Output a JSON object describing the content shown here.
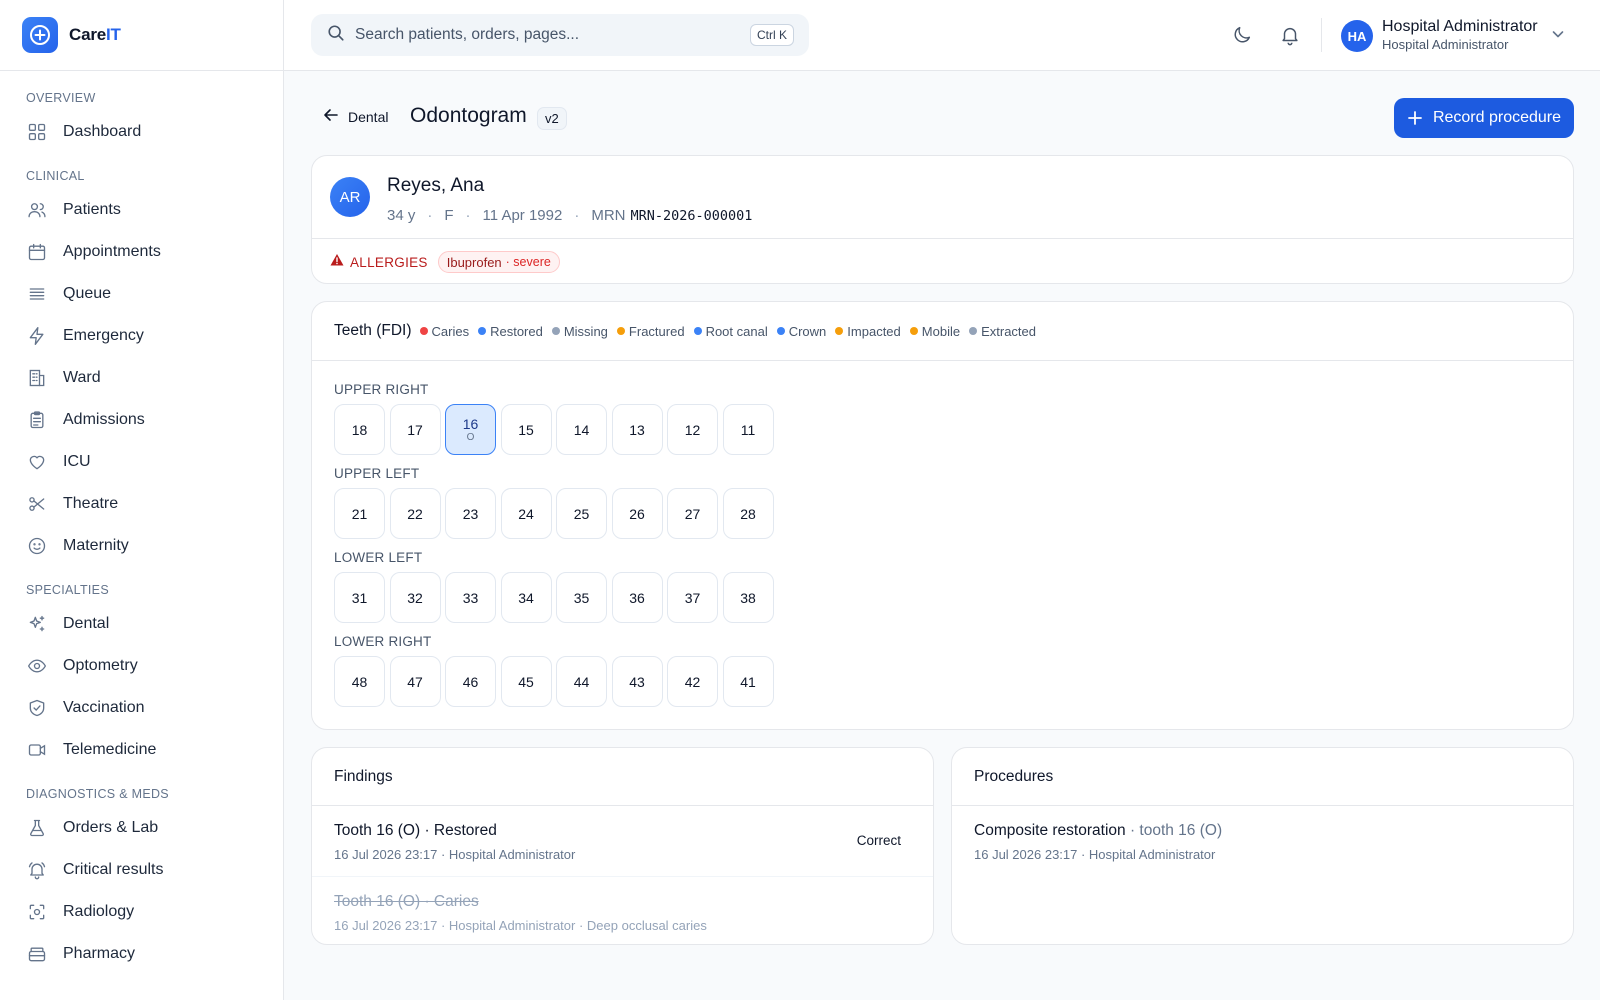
{
  "brand": {
    "name_main": "Care",
    "name_accent": "IT"
  },
  "sidebar": {
    "sections": [
      {
        "title": "OVERVIEW",
        "items": [
          {
            "label": "Dashboard",
            "icon": "grid-icon"
          }
        ]
      },
      {
        "title": "CLINICAL",
        "items": [
          {
            "label": "Patients",
            "icon": "users-icon"
          },
          {
            "label": "Appointments",
            "icon": "calendar-icon"
          },
          {
            "label": "Queue",
            "icon": "list-icon"
          },
          {
            "label": "Emergency",
            "icon": "bolt-icon"
          },
          {
            "label": "Ward",
            "icon": "building-icon"
          },
          {
            "label": "Admissions",
            "icon": "clipboard-icon"
          },
          {
            "label": "ICU",
            "icon": "heart-icon"
          },
          {
            "label": "Theatre",
            "icon": "scissors-icon"
          },
          {
            "label": "Maternity",
            "icon": "smile-icon"
          }
        ]
      },
      {
        "title": "SPECIALTIES",
        "items": [
          {
            "label": "Dental",
            "icon": "sparkles-icon"
          },
          {
            "label": "Optometry",
            "icon": "eye-icon"
          },
          {
            "label": "Vaccination",
            "icon": "shield-icon"
          },
          {
            "label": "Telemedicine",
            "icon": "video-icon"
          }
        ]
      },
      {
        "title": "DIAGNOSTICS & MEDS",
        "items": [
          {
            "label": "Orders & Lab",
            "icon": "flask-icon"
          },
          {
            "label": "Critical results",
            "icon": "bell-alert-icon"
          },
          {
            "label": "Radiology",
            "icon": "scan-icon"
          },
          {
            "label": "Pharmacy",
            "icon": "pill-box-icon"
          }
        ]
      }
    ]
  },
  "header": {
    "search_placeholder": "Search patients, orders, pages...",
    "shortcut": "Ctrl K",
    "user_initials": "HA",
    "user_name": "Hospital Administrator",
    "user_role": "Hospital Administrator"
  },
  "page": {
    "back_label": "Dental",
    "title": "Odontogram",
    "version": "v2",
    "primary_action": "Record procedure"
  },
  "patient": {
    "initials": "AR",
    "name": "Reyes, Ana",
    "age": "34 y",
    "sex": "F",
    "dob": "11 Apr 1992",
    "mrn_label": "MRN",
    "mrn": "MRN-2026-000001",
    "allergies_label": "ALLERGIES",
    "allergy": "Ibuprofen",
    "allergy_severity": "· severe"
  },
  "teeth": {
    "title": "Teeth (FDI)",
    "legend": [
      {
        "label": "Caries",
        "color": "#ef4444"
      },
      {
        "label": "Restored",
        "color": "#3b82f6"
      },
      {
        "label": "Missing",
        "color": "#94a3b8"
      },
      {
        "label": "Fractured",
        "color": "#f59e0b"
      },
      {
        "label": "Root canal",
        "color": "#3b82f6"
      },
      {
        "label": "Crown",
        "color": "#3b82f6"
      },
      {
        "label": "Impacted",
        "color": "#f59e0b"
      },
      {
        "label": "Mobile",
        "color": "#f59e0b"
      },
      {
        "label": "Extracted",
        "color": "#94a3b8"
      }
    ],
    "quadrants": [
      {
        "label": "UPPER RIGHT",
        "teeth": [
          {
            "num": "18"
          },
          {
            "num": "17"
          },
          {
            "num": "16",
            "surface": "O",
            "selected": true
          },
          {
            "num": "15"
          },
          {
            "num": "14"
          },
          {
            "num": "13"
          },
          {
            "num": "12"
          },
          {
            "num": "11"
          }
        ]
      },
      {
        "label": "UPPER LEFT",
        "teeth": [
          {
            "num": "21"
          },
          {
            "num": "22"
          },
          {
            "num": "23"
          },
          {
            "num": "24"
          },
          {
            "num": "25"
          },
          {
            "num": "26"
          },
          {
            "num": "27"
          },
          {
            "num": "28"
          }
        ]
      },
      {
        "label": "LOWER LEFT",
        "teeth": [
          {
            "num": "31"
          },
          {
            "num": "32"
          },
          {
            "num": "33"
          },
          {
            "num": "34"
          },
          {
            "num": "35"
          },
          {
            "num": "36"
          },
          {
            "num": "37"
          },
          {
            "num": "38"
          }
        ]
      },
      {
        "label": "LOWER RIGHT",
        "teeth": [
          {
            "num": "48"
          },
          {
            "num": "47"
          },
          {
            "num": "46"
          },
          {
            "num": "45"
          },
          {
            "num": "44"
          },
          {
            "num": "43"
          },
          {
            "num": "42"
          },
          {
            "num": "41"
          }
        ]
      }
    ]
  },
  "findings": {
    "title": "Findings",
    "items": [
      {
        "title": "Tooth 16 (O) · Restored",
        "sub": "16 Jul 2026 23:17 · Hospital Administrator",
        "action": "Correct",
        "struck": false
      },
      {
        "title": "Tooth 16 (O) · Caries",
        "sub": "16 Jul 2026 23:17 · Hospital Administrator · Deep occlusal caries",
        "struck": true
      }
    ]
  },
  "procedures": {
    "title": "Procedures",
    "items": [
      {
        "title": "Composite restoration",
        "detail": "· tooth 16 (O)",
        "sub": "16 Jul 2026 23:17 · Hospital Administrator"
      }
    ]
  }
}
